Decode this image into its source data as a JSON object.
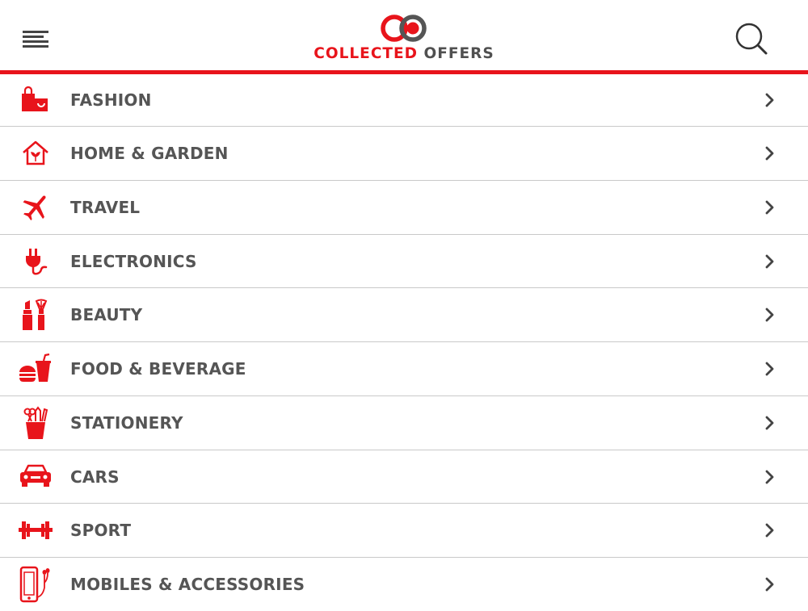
{
  "brand": {
    "word1": "COLLECTED",
    "word2": "OFFERS",
    "accent": "#e8141b",
    "text_gray": "#505050"
  },
  "header": {
    "menu_icon": "hamburger-menu-icon",
    "search_icon": "search-icon"
  },
  "categories": [
    {
      "label": "FASHION",
      "icon": "shopping-bags-icon"
    },
    {
      "label": "HOME & GARDEN",
      "icon": "house-plant-icon"
    },
    {
      "label": "TRAVEL",
      "icon": "airplane-icon"
    },
    {
      "label": "ELECTRONICS",
      "icon": "power-plug-icon"
    },
    {
      "label": "BEAUTY",
      "icon": "lipstick-brush-icon"
    },
    {
      "label": "FOOD & BEVERAGE",
      "icon": "burger-drink-icon"
    },
    {
      "label": "STATIONERY",
      "icon": "pencil-cup-icon"
    },
    {
      "label": "CARS",
      "icon": "car-icon"
    },
    {
      "label": "SPORT",
      "icon": "dumbbell-icon"
    },
    {
      "label": "MOBILES & ACCESSORIES",
      "icon": "mobile-earphones-icon"
    }
  ]
}
